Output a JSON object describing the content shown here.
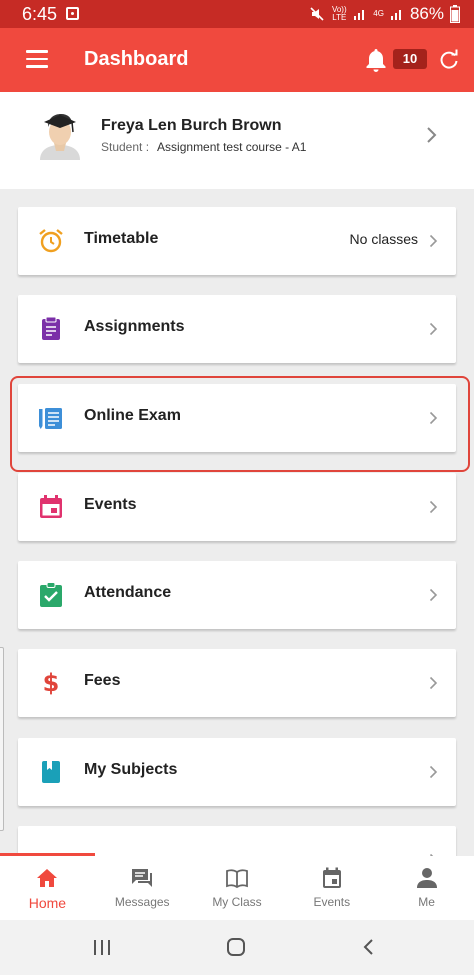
{
  "status_bar": {
    "time": "6:45",
    "battery": "86%",
    "volte": "Vo)) LTE",
    "net": "4G"
  },
  "app_bar": {
    "title": "Dashboard",
    "notification_count": "10"
  },
  "profile": {
    "name": "Freya Len Burch Brown",
    "role_label": "Student :",
    "course": "Assignment test course - A1"
  },
  "menu_items": [
    {
      "label": "Timetable",
      "extra": "No classes",
      "icon": "alarm-clock-icon",
      "color": "#f0a020"
    },
    {
      "label": "Assignments",
      "icon": "clipboard-icon",
      "color": "#7b2fa8"
    },
    {
      "label": "Online Exam",
      "icon": "exam-sheet-icon",
      "color": "#3d8fd8"
    },
    {
      "label": "Events",
      "icon": "calendar-icon",
      "color": "#e0336e"
    },
    {
      "label": "Attendance",
      "icon": "clipboard-check-icon",
      "color": "#2aa86a"
    },
    {
      "label": "Fees",
      "icon": "dollar-icon",
      "color": "#e0453b"
    },
    {
      "label": "My Subjects",
      "icon": "book-icon",
      "color": "#1aa0b8"
    }
  ],
  "bottom_nav": [
    {
      "label": "Home",
      "icon": "home-icon",
      "active": true
    },
    {
      "label": "Messages",
      "icon": "messages-icon"
    },
    {
      "label": "My Class",
      "icon": "open-book-icon"
    },
    {
      "label": "Events",
      "icon": "calendar-icon"
    },
    {
      "label": "Me",
      "icon": "person-icon"
    }
  ],
  "colors": {
    "primary": "#f0493e",
    "status_bar": "#c62b25",
    "highlight": "#e0453b"
  }
}
